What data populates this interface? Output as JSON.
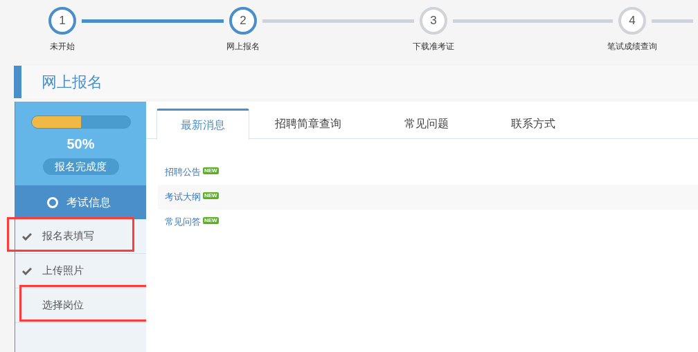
{
  "steps": [
    {
      "number": "1",
      "label": "未开始",
      "active": true
    },
    {
      "number": "2",
      "label": "网上报名",
      "active": true
    },
    {
      "number": "3",
      "label": "下载准考证",
      "active": false
    },
    {
      "number": "4",
      "label": "笔试成绩查询",
      "active": false
    }
  ],
  "section_title": "网上报名",
  "progress": {
    "level": 0.5,
    "percent": "50%",
    "caption": "报名完成度"
  },
  "sidebar": {
    "header": "考试信息",
    "items": [
      {
        "label": "报名表填写",
        "checked": true,
        "highlighted": true
      },
      {
        "label": "上传照片",
        "checked": true,
        "highlighted": false
      },
      {
        "label": "选择岗位",
        "checked": false,
        "highlighted": true
      }
    ]
  },
  "tabs": [
    {
      "label": "最新消息",
      "selected": true
    },
    {
      "label": "招聘简章查询",
      "selected": false
    },
    {
      "label": "常见问题",
      "selected": false
    },
    {
      "label": "联系方式",
      "selected": false
    }
  ],
  "news": [
    {
      "title": "招聘公告",
      "badge": "NEW"
    },
    {
      "title": "考试大纲",
      "badge": "NEW"
    },
    {
      "title": "常见问答",
      "badge": "NEW"
    }
  ]
}
